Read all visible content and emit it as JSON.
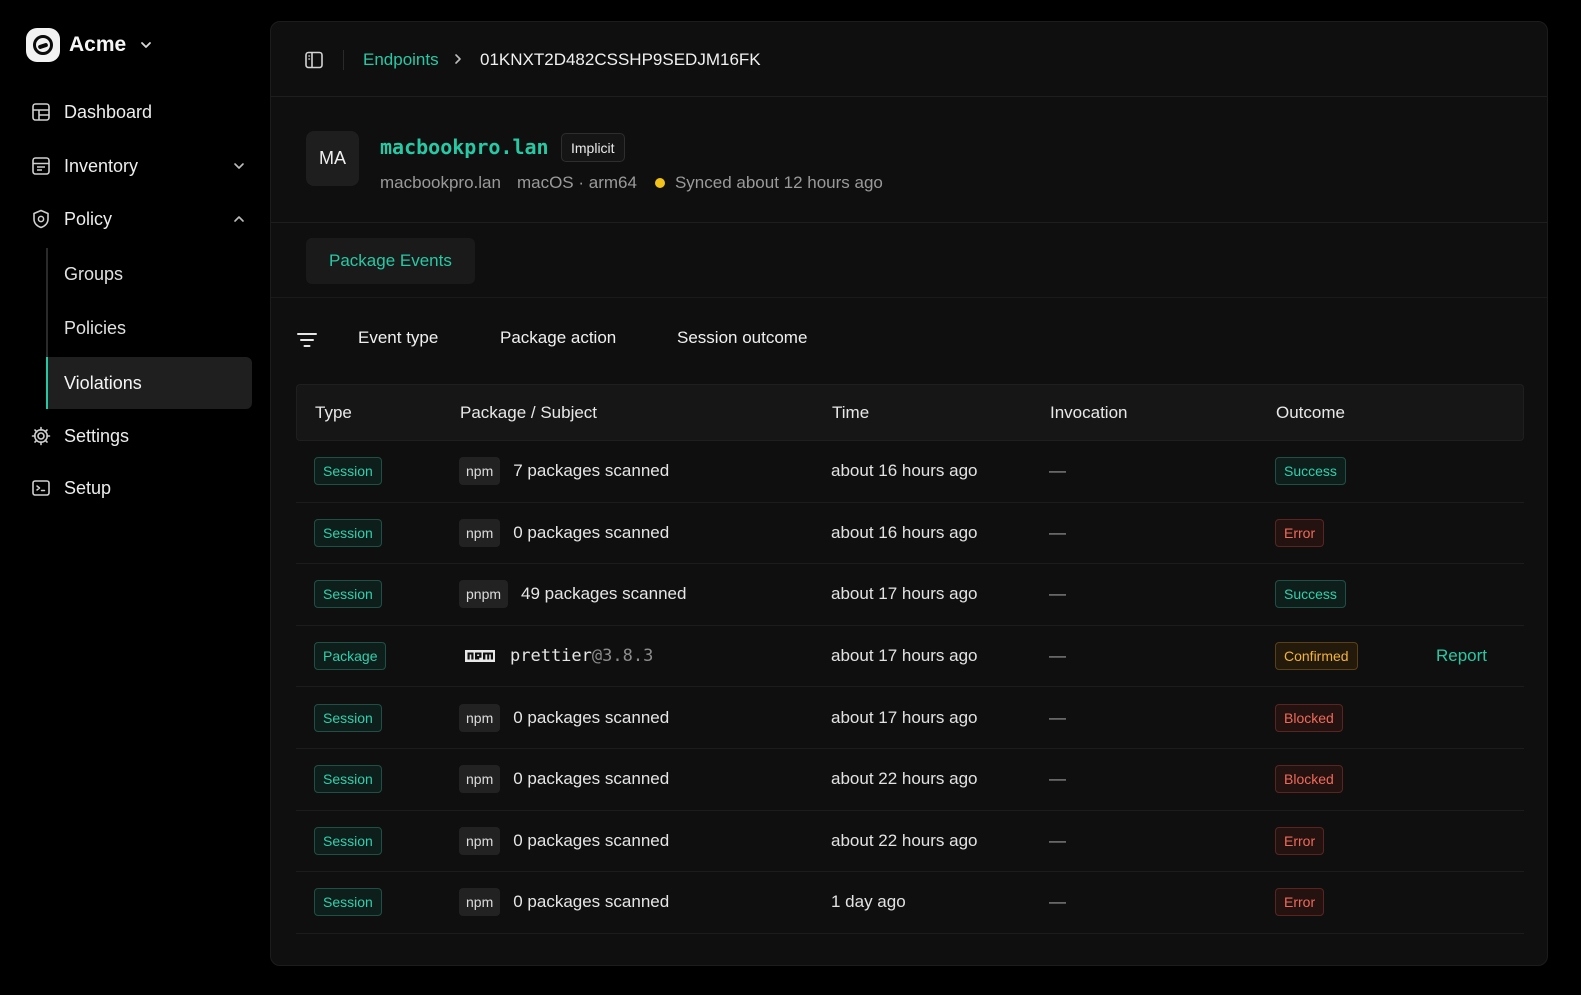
{
  "org": {
    "name": "Acme",
    "logo_icon": "acme-logo-icon",
    "chevron_icon": "chevron-down-icon"
  },
  "sidebar": {
    "items": [
      {
        "label": "Dashboard",
        "icon": "dashboard-icon"
      },
      {
        "label": "Inventory",
        "icon": "inventory-icon",
        "chevron": "chevron-down-icon"
      },
      {
        "label": "Policy",
        "icon": "policy-icon",
        "chevron": "chevron-up-icon"
      },
      {
        "label": "Settings",
        "icon": "gear-icon"
      },
      {
        "label": "Setup",
        "icon": "terminal-icon"
      }
    ],
    "policy_subitems": [
      {
        "label": "Groups"
      },
      {
        "label": "Policies"
      },
      {
        "label": "Violations",
        "active": true
      }
    ]
  },
  "topbar": {
    "toggle_icon": "sidebar-toggle-icon",
    "breadcrumb_link": "Endpoints",
    "breadcrumb_current": "01KNXT2D482CSSHP9SEDJM16FK"
  },
  "endpoint": {
    "avatar": "MA",
    "title": "macbookpro.lan",
    "badge": "Implicit",
    "hostname": "macbookpro.lan",
    "platform": "macOS · arm64",
    "sync_status": "Synced about 12 hours ago",
    "sync_color": "#f2c21b"
  },
  "tabs": [
    {
      "label": "Package Events",
      "active": true
    }
  ],
  "filters": {
    "icon": "filter-icon",
    "items": [
      "Event type",
      "Package action",
      "Session outcome"
    ]
  },
  "table": {
    "columns": [
      "Type",
      "Package / Subject",
      "Time",
      "Invocation",
      "Outcome"
    ],
    "rows": [
      {
        "type": "Session",
        "pm": "npm",
        "subject": "7 packages scanned",
        "time": "about 16 hours ago",
        "invocation": "—",
        "outcome": "Success",
        "outcome_kind": "success"
      },
      {
        "type": "Session",
        "pm": "npm",
        "subject": "0 packages scanned",
        "time": "about 16 hours ago",
        "invocation": "—",
        "outcome": "Error",
        "outcome_kind": "error"
      },
      {
        "type": "Session",
        "pm": "pnpm",
        "subject": "49 packages scanned",
        "time": "about 17 hours ago",
        "invocation": "—",
        "outcome": "Success",
        "outcome_kind": "success"
      },
      {
        "type": "Package",
        "pm_logo": "npm-logo-icon",
        "package_name": "prettier",
        "package_version": "@3.8.3",
        "time": "about 17 hours ago",
        "invocation": "—",
        "outcome": "Confirmed",
        "outcome_kind": "confirmed",
        "action": "Report"
      },
      {
        "type": "Session",
        "pm": "npm",
        "subject": "0 packages scanned",
        "time": "about 17 hours ago",
        "invocation": "—",
        "outcome": "Blocked",
        "outcome_kind": "error"
      },
      {
        "type": "Session",
        "pm": "npm",
        "subject": "0 packages scanned",
        "time": "about 22 hours ago",
        "invocation": "—",
        "outcome": "Blocked",
        "outcome_kind": "error"
      },
      {
        "type": "Session",
        "pm": "npm",
        "subject": "0 packages scanned",
        "time": "about 22 hours ago",
        "invocation": "—",
        "outcome": "Error",
        "outcome_kind": "error"
      },
      {
        "type": "Session",
        "pm": "npm",
        "subject": "0 packages scanned",
        "time": "1 day ago",
        "invocation": "—",
        "outcome": "Error",
        "outcome_kind": "error"
      }
    ]
  },
  "colors": {
    "accent": "#27c9a5",
    "error": "#f06a5a",
    "warning": "#f2b33a",
    "background": "#000000",
    "panel": "#0f0f0f"
  }
}
